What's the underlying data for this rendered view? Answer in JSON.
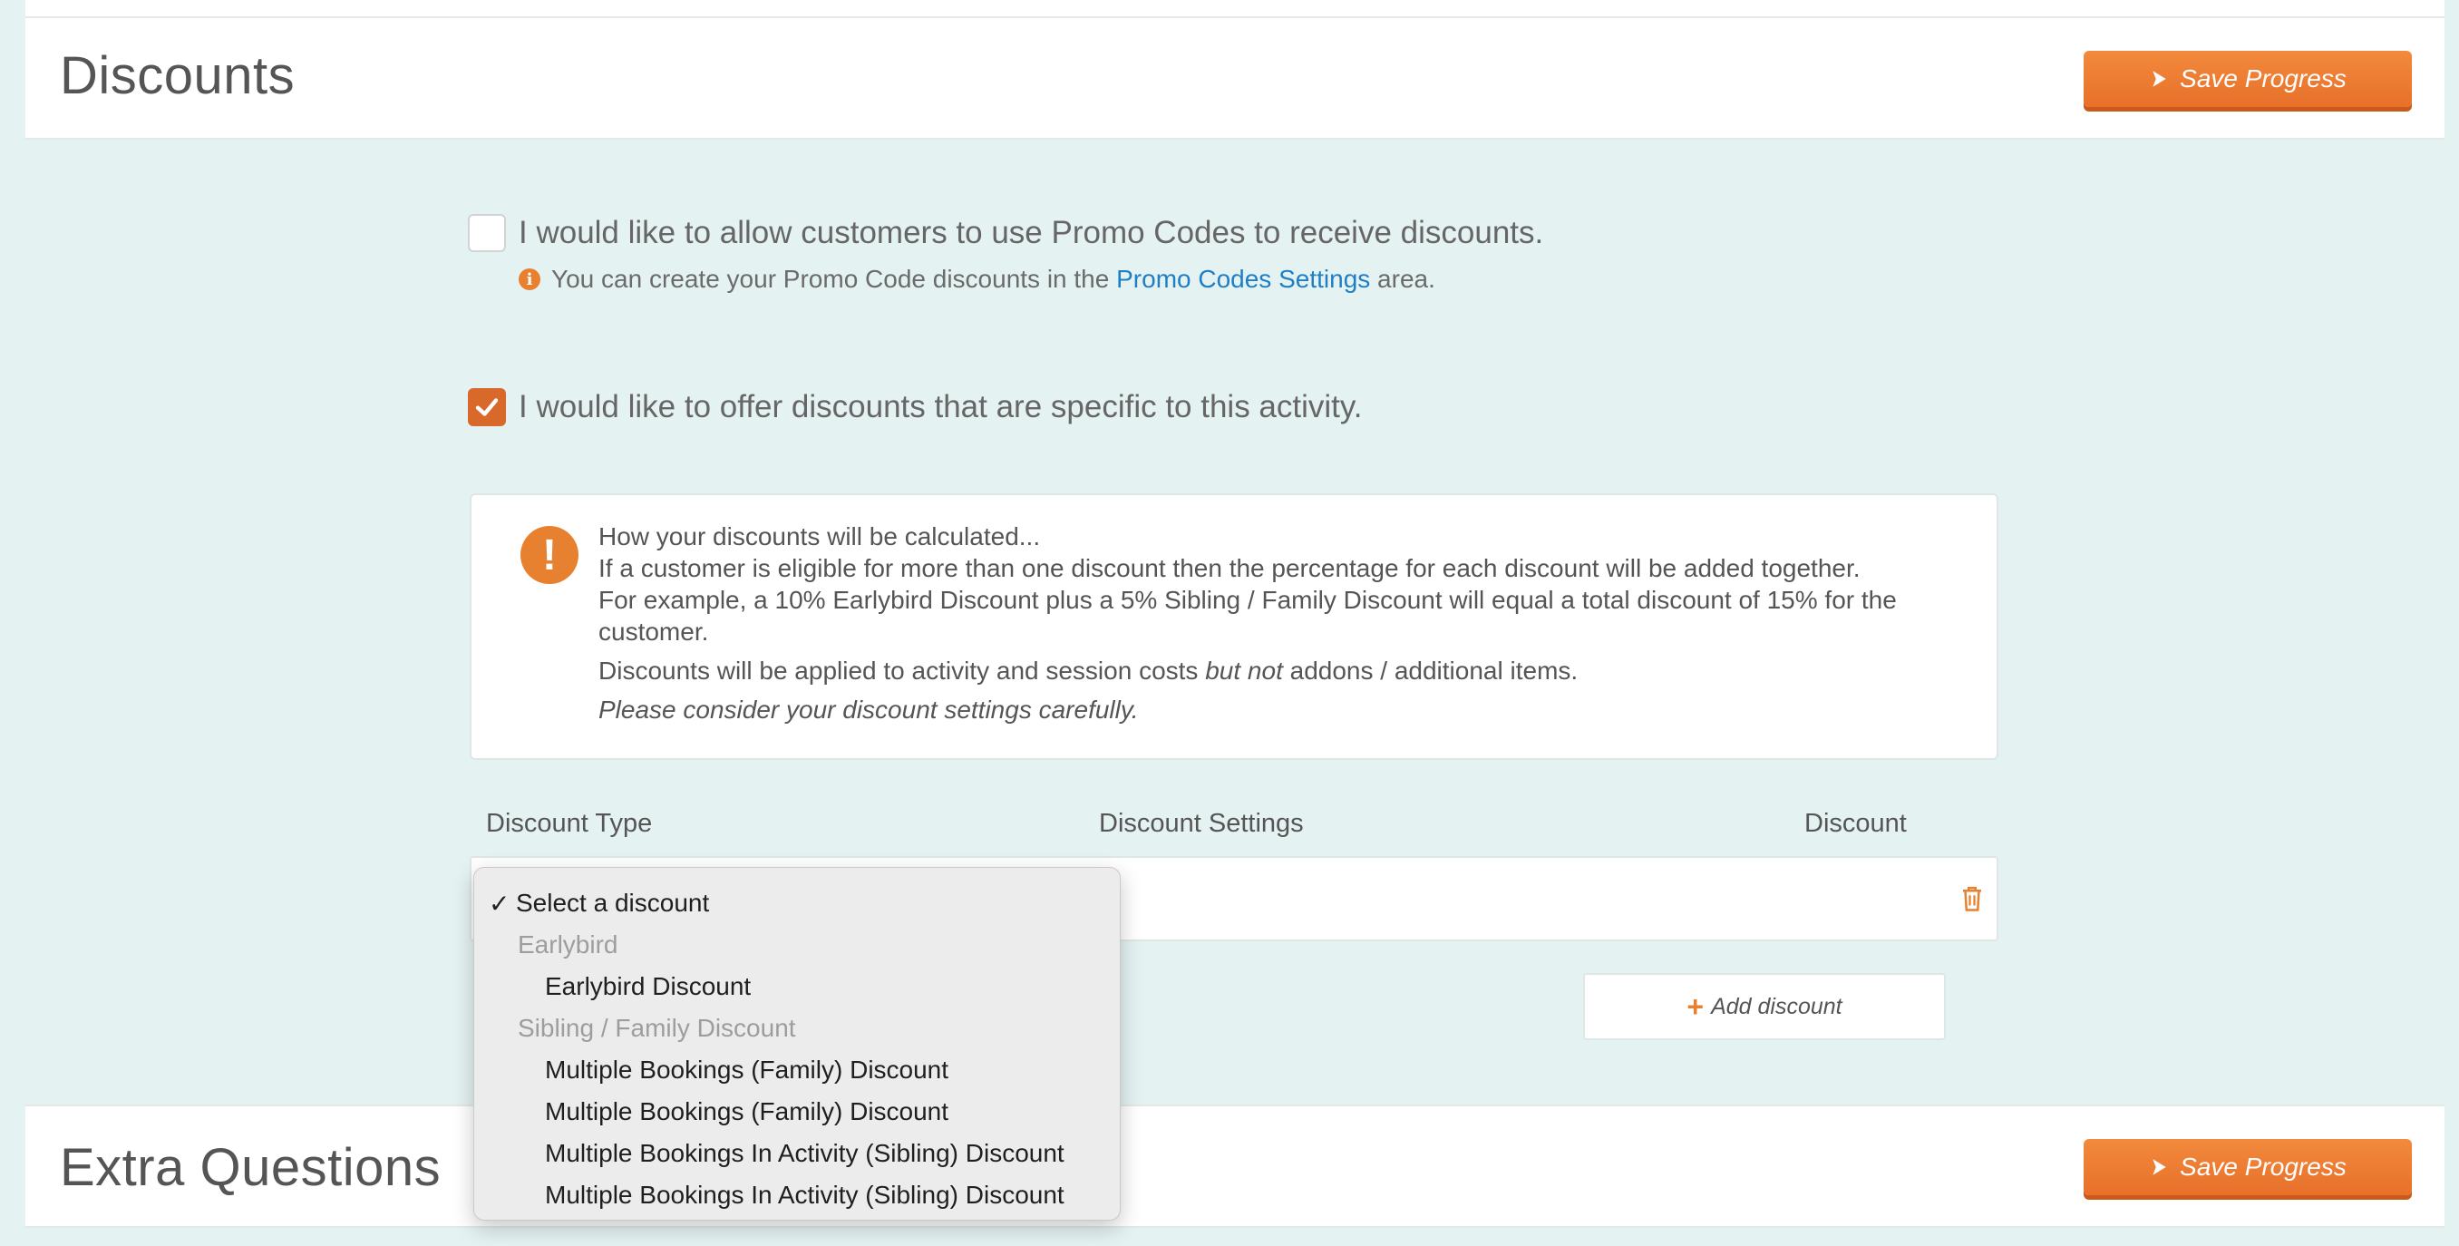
{
  "discounts_panel": {
    "title": "Discounts",
    "save_label": "Save Progress"
  },
  "promo": {
    "checked": false,
    "label": "I would like to allow customers to use Promo Codes to receive discounts.",
    "hint_prefix": "You can create your Promo Code discounts in the",
    "hint_link": "Promo Codes Settings",
    "hint_suffix": "area."
  },
  "specific": {
    "checked": true,
    "label": "I would like to offer discounts that are specific to this activity."
  },
  "notice": {
    "heading": "How your discounts will be calculated...",
    "line1": "If a customer is eligible for more than one discount then the percentage for each discount will be added together.",
    "line2": "For example, a 10% Earlybird Discount plus a 5% Sibling / Family Discount will equal a total discount of 15% for the customer.",
    "line3_prefix": "Discounts will be applied to activity and session costs",
    "line3_em": "but not",
    "line3_suffix": "addons / additional items.",
    "line4": "Please consider your discount settings carefully."
  },
  "table": {
    "headers": [
      "Discount Type",
      "Discount Settings",
      "Discount"
    ]
  },
  "add_discount_label": "Add discount",
  "dropdown": {
    "selected": "Select a discount",
    "tick": "✓",
    "groups": [
      {
        "label": "Earlybird",
        "options": [
          "Earlybird Discount"
        ]
      },
      {
        "label": "Sibling / Family Discount",
        "options": [
          "Multiple Bookings (Family) Discount",
          "Multiple Bookings (Family) Discount",
          "Multiple Bookings In Activity (Sibling) Discount",
          "Multiple Bookings In Activity (Sibling) Discount"
        ]
      }
    ]
  },
  "extra_panel": {
    "title": "Extra Questions",
    "save_label": "Save Progress"
  },
  "colors": {
    "accent": "#e8702a",
    "link": "#1e7fc6",
    "background": "#e5f2f2"
  }
}
